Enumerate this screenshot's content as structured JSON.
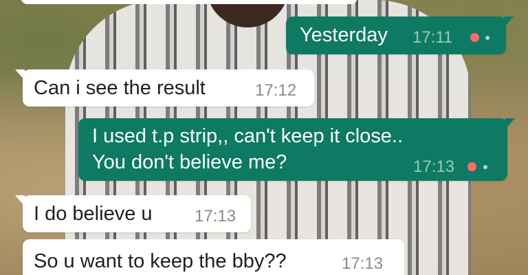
{
  "messages": [
    {
      "direction": "outgoing",
      "text": "Yesterday",
      "time": "17:11"
    },
    {
      "direction": "incoming",
      "text": "Can i see the result",
      "time": "17:12"
    },
    {
      "direction": "outgoing",
      "lines": [
        "I used t.p strip,, can't keep it close..",
        "You don't believe me?"
      ],
      "time": "17:13"
    },
    {
      "direction": "incoming",
      "text": "I do believe u",
      "time": "17:13"
    },
    {
      "direction": "incoming",
      "text": "So u want to keep the bby??",
      "time": "17:13"
    }
  ],
  "colors": {
    "outgoing_bubble": "#0e7a63",
    "incoming_bubble": "#ffffff",
    "status_dot": "#ff6b6b"
  },
  "icons": [
    "message-status-dot-icon"
  ]
}
